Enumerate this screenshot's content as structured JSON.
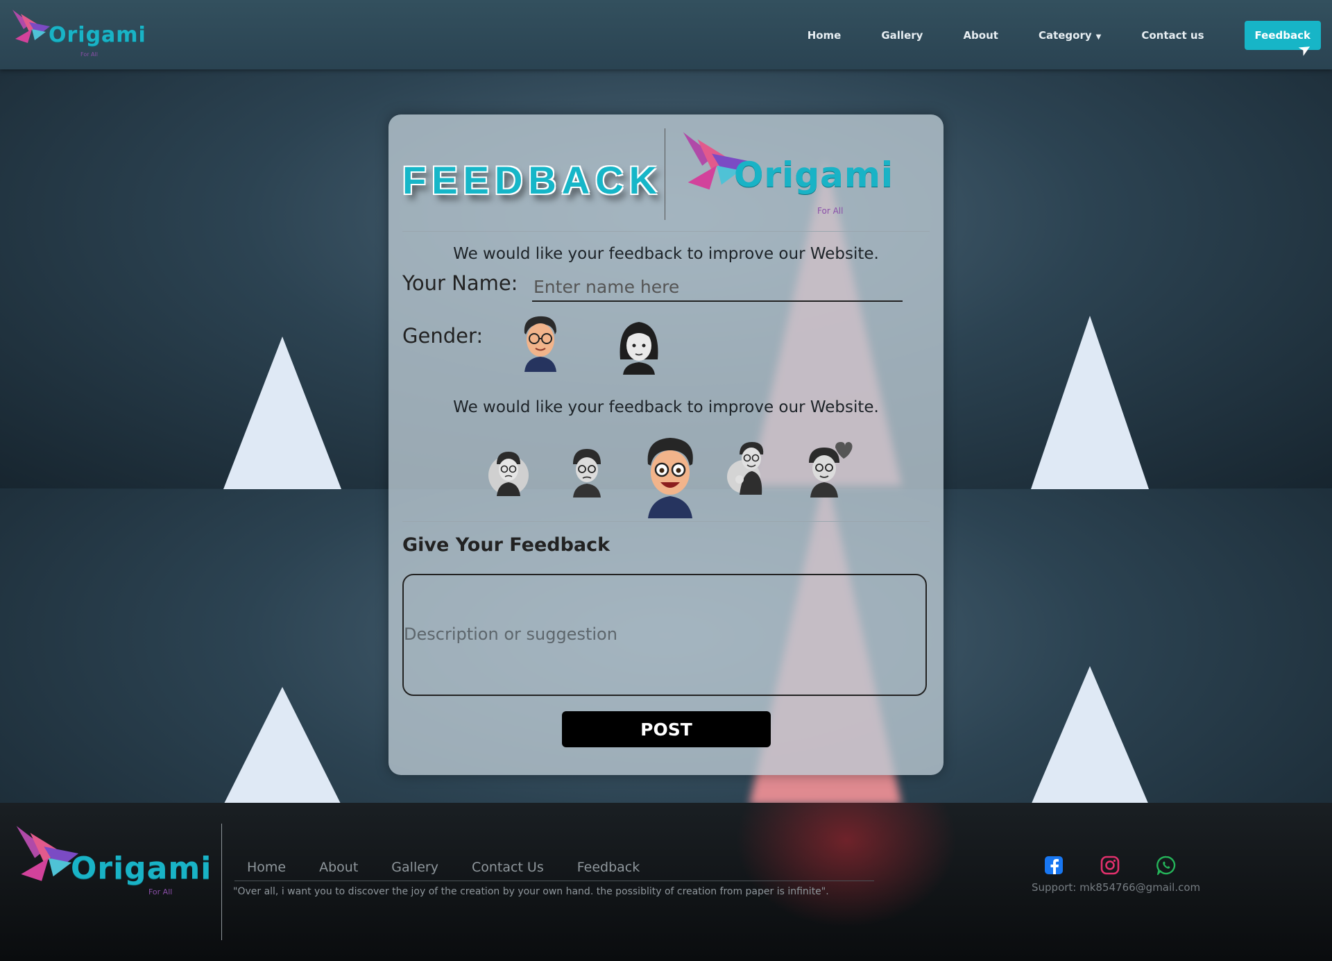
{
  "navbar": {
    "logo_text": "Origami",
    "logo_sub": "For All",
    "links": [
      "Home",
      "Gallery",
      "About",
      "Category",
      "Contact us"
    ],
    "feedback_button": "Feedback"
  },
  "card": {
    "title": "FEEDBACK",
    "logo_text": "Origami",
    "logo_sub": "For All",
    "intro_1": "We would like your feedback to improve our Website.",
    "name_label": "Your Name:",
    "name_placeholder": "Enter name here",
    "gender_label": "Gender:",
    "intro_2": "We would like your feedback to improve our Website.",
    "give_title": "Give Your Feedback",
    "description_placeholder": "Description or suggestion",
    "post_button": "POST"
  },
  "footer": {
    "logo_text": "Origami",
    "logo_sub": "For All",
    "links": [
      "Home",
      "About",
      "Gallery",
      "Contact Us",
      "Feedback"
    ],
    "quote": "\"Over all, i want you to discover the joy of the creation by your own hand. the possiblity of creation from paper is infinite\".",
    "support": "Support: mk854766@gmail.com"
  },
  "icons": {
    "social": [
      "facebook-icon",
      "instagram-icon",
      "whatsapp-icon"
    ],
    "colors": {
      "facebook": "#1877f2",
      "instagram": "#e1306c",
      "whatsapp": "#25b55a"
    }
  },
  "colors": {
    "accent": "#17b5c7",
    "card_bg": "#bccad4"
  }
}
